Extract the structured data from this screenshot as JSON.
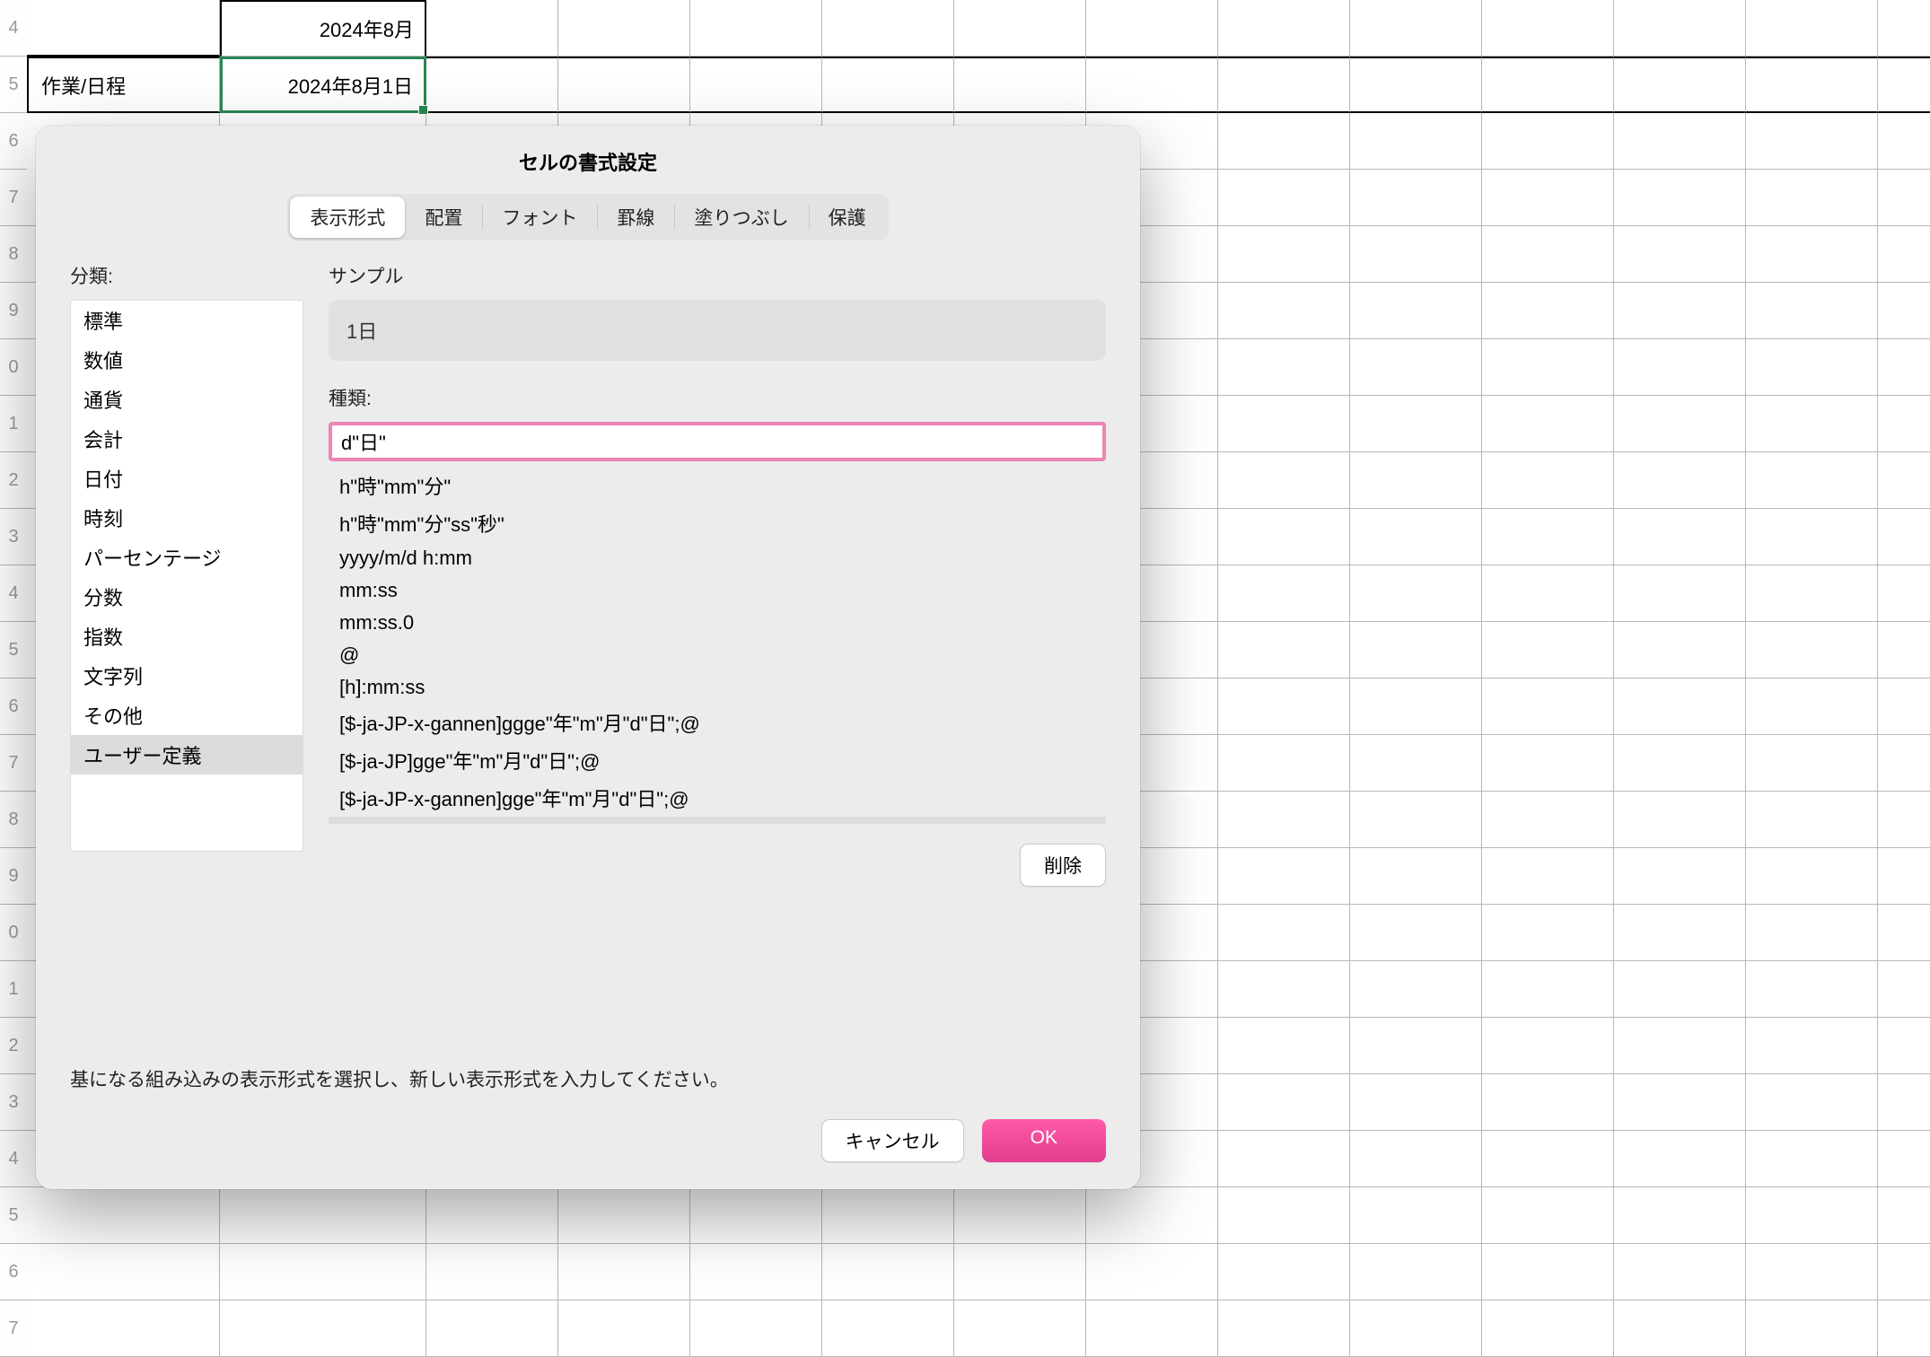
{
  "sheet": {
    "row_headers": [
      "4",
      "5",
      "6",
      "7",
      "8",
      "9",
      "0",
      "1",
      "2",
      "3",
      "4",
      "5",
      "6",
      "7",
      "8",
      "9",
      "0",
      "1",
      "2",
      "3",
      "4",
      "5",
      "6",
      "7"
    ],
    "cells": {
      "month": "2024年8月",
      "selected_date": "2024年8月1日",
      "task_label": "作業/日程"
    }
  },
  "dialog": {
    "title": "セルの書式設定",
    "tabs": [
      "表示形式",
      "配置",
      "フォント",
      "罫線",
      "塗りつぶし",
      "保護"
    ],
    "active_tab": 0,
    "category_label": "分類:",
    "categories": [
      "標準",
      "数値",
      "通貨",
      "会計",
      "日付",
      "時刻",
      "パーセンテージ",
      "分数",
      "指数",
      "文字列",
      "その他",
      "ユーザー定義"
    ],
    "selected_category": 11,
    "sample_label": "サンプル",
    "sample_value": "1日",
    "type_label": "種類:",
    "type_value": "d\"日\"",
    "formats": [
      "h\"時\"mm\"分\"",
      "h\"時\"mm\"分\"ss\"秒\"",
      "yyyy/m/d h:mm",
      "mm:ss",
      "mm:ss.0",
      "@",
      "[h]:mm:ss",
      "[$-ja-JP-x-gannen]ggge\"年\"m\"月\"d\"日\";@",
      "[$-ja-JP]gge\"年\"m\"月\"d\"日\";@",
      "[$-ja-JP-x-gannen]gge\"年\"m\"月\"d\"日\";@",
      "d\"日\""
    ],
    "selected_format": 10,
    "delete_label": "削除",
    "note": "基になる組み込みの表示形式を選択し、新しい表示形式を入力してください。",
    "cancel_label": "キャンセル",
    "ok_label": "OK"
  }
}
